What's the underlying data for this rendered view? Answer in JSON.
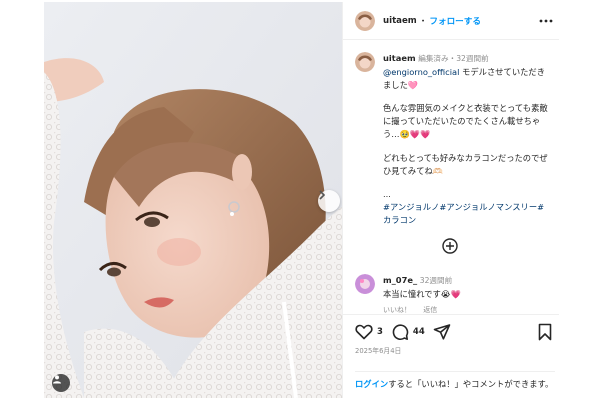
{
  "post": {
    "author": "uitaem",
    "separator": "・",
    "follow_label": "フォローする"
  },
  "caption": {
    "username": "uitaem",
    "edited": "編集済み・32週間前",
    "mention": "@engiorno_official",
    "line1": " モデルさせていただきました🩷",
    "para2": "色んな雰囲気のメイクと衣装でとっても素敵に撮っていただいたのでたくさん載せちゃう…🥹💗💗",
    "para3": "どれもとっても好みなカラコンだったのでぜひ見てみてね🫶🏻",
    "ellipsis": "...",
    "hashtags": "#アンジョルノ#アンジョルノマンスリー#カラコン"
  },
  "comment": {
    "username": "m_07e_",
    "time": "32週間前",
    "text": "本当に憧れです😭💗",
    "like_label": "いいね！",
    "reply_label": "返信"
  },
  "stats": {
    "likes": "3",
    "comments": "44",
    "date": "2025年6月4日"
  },
  "login": {
    "link": "ログイン",
    "rest": "すると「いいね！」やコメントができます。"
  },
  "colors": {
    "link_blue": "#0095f6",
    "hashtag": "#00376b",
    "muted": "#8e8e8e"
  }
}
